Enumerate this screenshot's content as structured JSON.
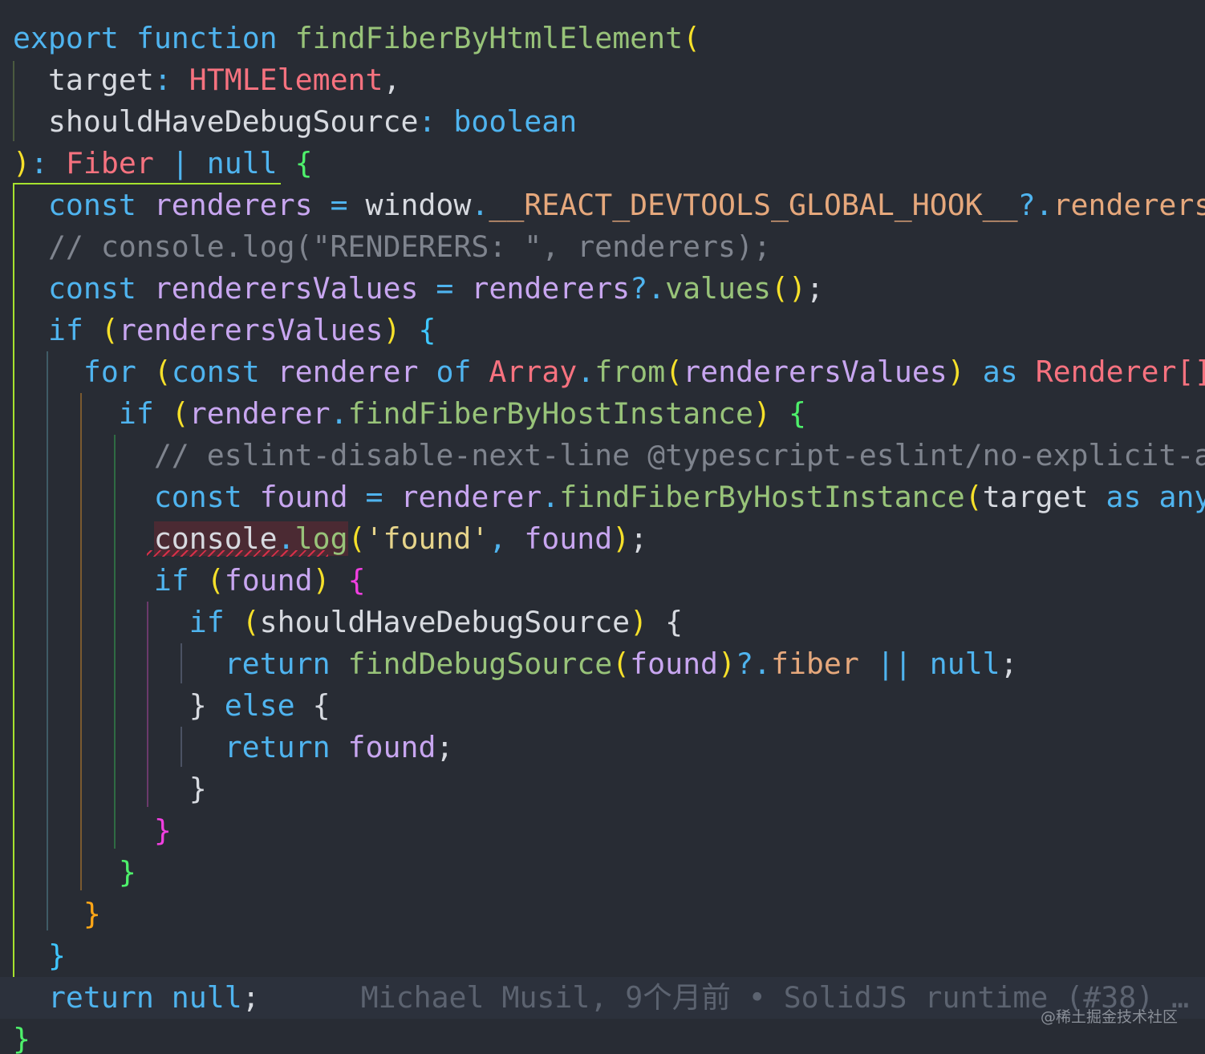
{
  "editor": {
    "colors": {
      "background": "#282c34",
      "keyword": "#4fb4ef",
      "function": "#98c379",
      "variable": "#c8a6f0",
      "property": "#e6a87c",
      "type": "#f6727f",
      "plain": "#d7dae0",
      "string": "#e6d48b",
      "comment": "#7f848e",
      "paren_yellow": "#f6e02a",
      "paren_green": "#4ef06b",
      "paren_blue": "#3fc6ff",
      "paren_magenta": "#f03fe0",
      "paren_orange": "#ffa617"
    },
    "blame": "Michael Musil, 9个月前 • SolidJS runtime (#38) …",
    "watermark": "@稀土掘金技术社区",
    "lines": [
      {
        "tokens": [
          {
            "t": "export",
            "c": "keyword"
          },
          {
            "t": " "
          },
          {
            "t": "function",
            "c": "keyword"
          },
          {
            "t": " "
          },
          {
            "t": "findFiberByHtmlElement",
            "c": "function"
          },
          {
            "t": "(",
            "c": "paren_yellow"
          }
        ]
      },
      {
        "tokens": [
          {
            "t": "  "
          },
          {
            "t": "target",
            "c": "plain"
          },
          {
            "t": ": ",
            "c": "keyword"
          },
          {
            "t": "HTMLElement",
            "c": "type"
          },
          {
            "t": ",",
            "c": "plain"
          }
        ]
      },
      {
        "tokens": [
          {
            "t": "  "
          },
          {
            "t": "shouldHaveDebugSource",
            "c": "plain"
          },
          {
            "t": ": ",
            "c": "keyword"
          },
          {
            "t": "boolean",
            "c": "keyword"
          }
        ]
      },
      {
        "tokens": [
          {
            "t": ")",
            "c": "paren_yellow"
          },
          {
            "t": ": ",
            "c": "keyword"
          },
          {
            "t": "Fiber",
            "c": "type"
          },
          {
            "t": " | ",
            "c": "keyword"
          },
          {
            "t": "null",
            "c": "keyword"
          },
          {
            "t": " "
          },
          {
            "t": "{",
            "c": "paren_green"
          }
        ]
      },
      {
        "tokens": [
          {
            "t": "  "
          },
          {
            "t": "const",
            "c": "keyword"
          },
          {
            "t": " "
          },
          {
            "t": "renderers",
            "c": "variable"
          },
          {
            "t": " = ",
            "c": "keyword"
          },
          {
            "t": "window",
            "c": "plain"
          },
          {
            "t": ".",
            "c": "keyword"
          },
          {
            "t": "__REACT_DEVTOOLS_GLOBAL_HOOK__",
            "c": "property"
          },
          {
            "t": "?.",
            "c": "keyword"
          },
          {
            "t": "renderers",
            "c": "property"
          },
          {
            "t": ";",
            "c": "plain"
          }
        ]
      },
      {
        "tokens": [
          {
            "t": "  "
          },
          {
            "t": "// console.log(\"RENDERERS: \", renderers);",
            "c": "comment"
          }
        ]
      },
      {
        "tokens": [
          {
            "t": "  "
          },
          {
            "t": "const",
            "c": "keyword"
          },
          {
            "t": " "
          },
          {
            "t": "renderersValues",
            "c": "variable"
          },
          {
            "t": " = ",
            "c": "keyword"
          },
          {
            "t": "renderers",
            "c": "variable"
          },
          {
            "t": "?.",
            "c": "keyword"
          },
          {
            "t": "values",
            "c": "function"
          },
          {
            "t": "()",
            "c": "paren_yellow"
          },
          {
            "t": ";",
            "c": "plain"
          }
        ]
      },
      {
        "tokens": [
          {
            "t": "  "
          },
          {
            "t": "if",
            "c": "keyword"
          },
          {
            "t": " "
          },
          {
            "t": "(",
            "c": "paren_yellow"
          },
          {
            "t": "renderersValues",
            "c": "variable"
          },
          {
            "t": ")",
            "c": "paren_yellow"
          },
          {
            "t": " "
          },
          {
            "t": "{",
            "c": "paren_blue"
          }
        ]
      },
      {
        "tokens": [
          {
            "t": "    "
          },
          {
            "t": "for",
            "c": "keyword"
          },
          {
            "t": " "
          },
          {
            "t": "(",
            "c": "paren_yellow"
          },
          {
            "t": "const",
            "c": "keyword"
          },
          {
            "t": " "
          },
          {
            "t": "renderer",
            "c": "variable"
          },
          {
            "t": " "
          },
          {
            "t": "of",
            "c": "keyword"
          },
          {
            "t": " "
          },
          {
            "t": "Array",
            "c": "type"
          },
          {
            "t": ".",
            "c": "keyword"
          },
          {
            "t": "from",
            "c": "function"
          },
          {
            "t": "(",
            "c": "paren_yellow"
          },
          {
            "t": "renderersValues",
            "c": "variable"
          },
          {
            "t": ")",
            "c": "paren_yellow"
          },
          {
            "t": " "
          },
          {
            "t": "as",
            "c": "keyword"
          },
          {
            "t": " "
          },
          {
            "t": "Renderer",
            "c": "type"
          },
          {
            "t": "[]",
            "c": "type"
          },
          {
            "t": ")",
            "c": "paren_yellow"
          },
          {
            "t": " "
          },
          {
            "t": "{",
            "c": "paren_orange"
          }
        ]
      },
      {
        "tokens": [
          {
            "t": "      "
          },
          {
            "t": "if",
            "c": "keyword"
          },
          {
            "t": " "
          },
          {
            "t": "(",
            "c": "paren_yellow"
          },
          {
            "t": "renderer",
            "c": "variable"
          },
          {
            "t": ".",
            "c": "keyword"
          },
          {
            "t": "findFiberByHostInstance",
            "c": "function"
          },
          {
            "t": ")",
            "c": "paren_yellow"
          },
          {
            "t": " "
          },
          {
            "t": "{",
            "c": "paren_green"
          }
        ]
      },
      {
        "tokens": [
          {
            "t": "        "
          },
          {
            "t": "// eslint-disable-next-line @typescript-eslint/no-explicit-any",
            "c": "comment"
          }
        ]
      },
      {
        "tokens": [
          {
            "t": "        "
          },
          {
            "t": "const",
            "c": "keyword"
          },
          {
            "t": " "
          },
          {
            "t": "found",
            "c": "variable"
          },
          {
            "t": " = ",
            "c": "keyword"
          },
          {
            "t": "renderer",
            "c": "variable"
          },
          {
            "t": ".",
            "c": "keyword"
          },
          {
            "t": "findFiberByHostInstance",
            "c": "function"
          },
          {
            "t": "(",
            "c": "paren_yellow"
          },
          {
            "t": "target",
            "c": "plain"
          },
          {
            "t": " "
          },
          {
            "t": "as",
            "c": "keyword"
          },
          {
            "t": " "
          },
          {
            "t": "any",
            "c": "keyword"
          },
          {
            "t": ")",
            "c": "paren_yellow"
          },
          {
            "t": ";",
            "c": "plain"
          }
        ]
      },
      {
        "tokens": [
          {
            "t": "        "
          },
          {
            "t": "console",
            "c": "plain",
            "err": true
          },
          {
            "t": ".",
            "c": "keyword",
            "err": true
          },
          {
            "t": "log",
            "c": "function",
            "err": true
          },
          {
            "t": "(",
            "c": "paren_yellow"
          },
          {
            "t": "'found'",
            "c": "string"
          },
          {
            "t": ", ",
            "c": "keyword"
          },
          {
            "t": "found",
            "c": "variable"
          },
          {
            "t": ")",
            "c": "paren_yellow"
          },
          {
            "t": ";",
            "c": "plain"
          }
        ]
      },
      {
        "tokens": [
          {
            "t": "        "
          },
          {
            "t": "if",
            "c": "keyword"
          },
          {
            "t": " "
          },
          {
            "t": "(",
            "c": "paren_yellow"
          },
          {
            "t": "found",
            "c": "variable"
          },
          {
            "t": ")",
            "c": "paren_yellow"
          },
          {
            "t": " "
          },
          {
            "t": "{",
            "c": "paren_magenta"
          }
        ]
      },
      {
        "tokens": [
          {
            "t": "          "
          },
          {
            "t": "if",
            "c": "keyword"
          },
          {
            "t": " "
          },
          {
            "t": "(",
            "c": "paren_yellow"
          },
          {
            "t": "shouldHaveDebugSource",
            "c": "plain"
          },
          {
            "t": ")",
            "c": "paren_yellow"
          },
          {
            "t": " "
          },
          {
            "t": "{",
            "c": "plain"
          }
        ]
      },
      {
        "tokens": [
          {
            "t": "            "
          },
          {
            "t": "return",
            "c": "keyword"
          },
          {
            "t": " "
          },
          {
            "t": "findDebugSource",
            "c": "function"
          },
          {
            "t": "(",
            "c": "paren_yellow"
          },
          {
            "t": "found",
            "c": "variable"
          },
          {
            "t": ")",
            "c": "paren_yellow"
          },
          {
            "t": "?.",
            "c": "keyword"
          },
          {
            "t": "fiber",
            "c": "property"
          },
          {
            "t": " || ",
            "c": "keyword"
          },
          {
            "t": "null",
            "c": "keyword"
          },
          {
            "t": ";",
            "c": "plain"
          }
        ]
      },
      {
        "tokens": [
          {
            "t": "          "
          },
          {
            "t": "}",
            "c": "plain"
          },
          {
            "t": " "
          },
          {
            "t": "else",
            "c": "keyword"
          },
          {
            "t": " "
          },
          {
            "t": "{",
            "c": "plain"
          }
        ]
      },
      {
        "tokens": [
          {
            "t": "            "
          },
          {
            "t": "return",
            "c": "keyword"
          },
          {
            "t": " "
          },
          {
            "t": "found",
            "c": "variable"
          },
          {
            "t": ";",
            "c": "plain"
          }
        ]
      },
      {
        "tokens": [
          {
            "t": "          "
          },
          {
            "t": "}",
            "c": "plain"
          }
        ]
      },
      {
        "tokens": [
          {
            "t": "        "
          },
          {
            "t": "}",
            "c": "paren_magenta"
          }
        ]
      },
      {
        "tokens": [
          {
            "t": "      "
          },
          {
            "t": "}",
            "c": "paren_green"
          }
        ]
      },
      {
        "tokens": [
          {
            "t": "    "
          },
          {
            "t": "}",
            "c": "paren_orange"
          }
        ]
      },
      {
        "tokens": [
          {
            "t": "  "
          },
          {
            "t": "}",
            "c": "paren_blue"
          }
        ]
      },
      {
        "tokens": [
          {
            "t": "  "
          },
          {
            "t": "return",
            "c": "keyword"
          },
          {
            "t": " "
          },
          {
            "t": "null",
            "c": "keyword"
          },
          {
            "t": ";",
            "c": "plain"
          }
        ],
        "current": true,
        "blame": true
      },
      {
        "tokens": [
          {
            "t": "}",
            "c": "paren_green"
          }
        ]
      }
    ]
  }
}
